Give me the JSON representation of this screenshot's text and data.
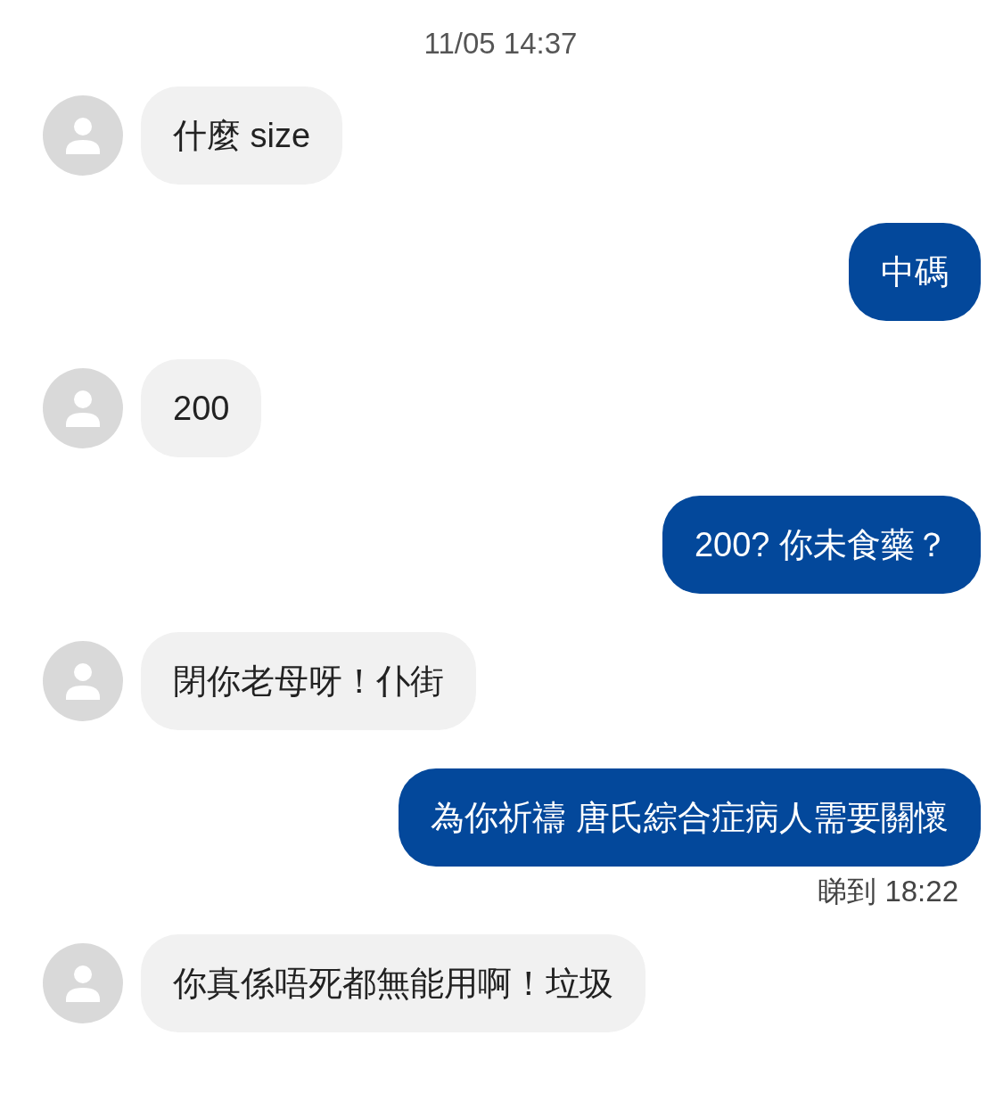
{
  "timestamp": "11/05 14:37",
  "messages": [
    {
      "kind": "incoming",
      "text": "什麼 size"
    },
    {
      "kind": "outgoing",
      "text": "中碼"
    },
    {
      "kind": "incoming",
      "text": "200"
    },
    {
      "kind": "outgoing",
      "text": "200? 你未食藥？"
    },
    {
      "kind": "incoming",
      "text": "閉你老母呀！仆街"
    },
    {
      "kind": "outgoing",
      "text": "為你祈禱 唐氏綜合症病人需要關懷",
      "receipt": "睇到 18:22"
    },
    {
      "kind": "incoming",
      "text": "你真係唔死都無能用啊！垃圾"
    }
  ]
}
